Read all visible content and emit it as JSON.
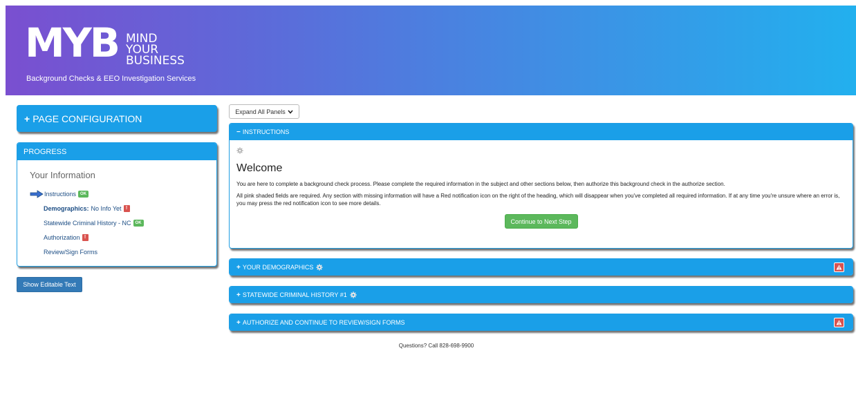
{
  "header": {
    "logo_letters": "MYB",
    "logo_words": [
      "MIND",
      "YOUR",
      "BUSINESS"
    ],
    "tagline": "Background Checks & EEO Investigation Services",
    "gradient_start": "#7a4fd0",
    "gradient_end": "#22b0ee"
  },
  "sidebar": {
    "page_config_label": "PAGE CONFIGURATION",
    "progress": {
      "title": "PROGRESS",
      "section_title": "Your Information",
      "items": [
        {
          "label": "Instructions",
          "prefix": "",
          "status": "OK",
          "current": true
        },
        {
          "label": "No Info Yet",
          "prefix": "Demographics:",
          "status": "!"
        },
        {
          "label": "Statewide Criminal History  - NC",
          "prefix": "",
          "status": "OK"
        },
        {
          "label": "Authorization",
          "prefix": "",
          "status": "!"
        },
        {
          "label": "Review/Sign Forms",
          "prefix": "",
          "status": ""
        }
      ]
    },
    "show_editable_label": "Show Editable Text"
  },
  "main": {
    "expand_label": "Expand All Panels",
    "instructions": {
      "title": "INSTRUCTIONS",
      "welcome": "Welcome",
      "paragraph1": "You are here to complete a background check process. Please complete the required information in the subject and other sections below, then authorize this background check in the authorize section.",
      "paragraph2": "All pink shaded fields are required. Any section with missing information will have a Red notification icon on the right of the heading, which will disappear when you've completed all required information. If at any time you're unsure where an error is, you may press the red notification icon to see more details.",
      "continue_label": "Continue to Next Step"
    },
    "panels": [
      {
        "title": "YOUR DEMOGRAPHICS",
        "gear": true,
        "warning": true
      },
      {
        "title": "STATEWIDE CRIMINAL HISTORY #1",
        "gear": true,
        "warning": false
      },
      {
        "title": "AUTHORIZE AND CONTINUE TO REVIEW/SIGN FORMS",
        "gear": false,
        "warning": true
      }
    ],
    "footer": "Questions? Call 828-698-9900"
  },
  "colors": {
    "panel_blue": "#1a9fe8",
    "ok_green": "#5cb85c",
    "error_red": "#d9534f",
    "button_blue": "#337ab7"
  }
}
